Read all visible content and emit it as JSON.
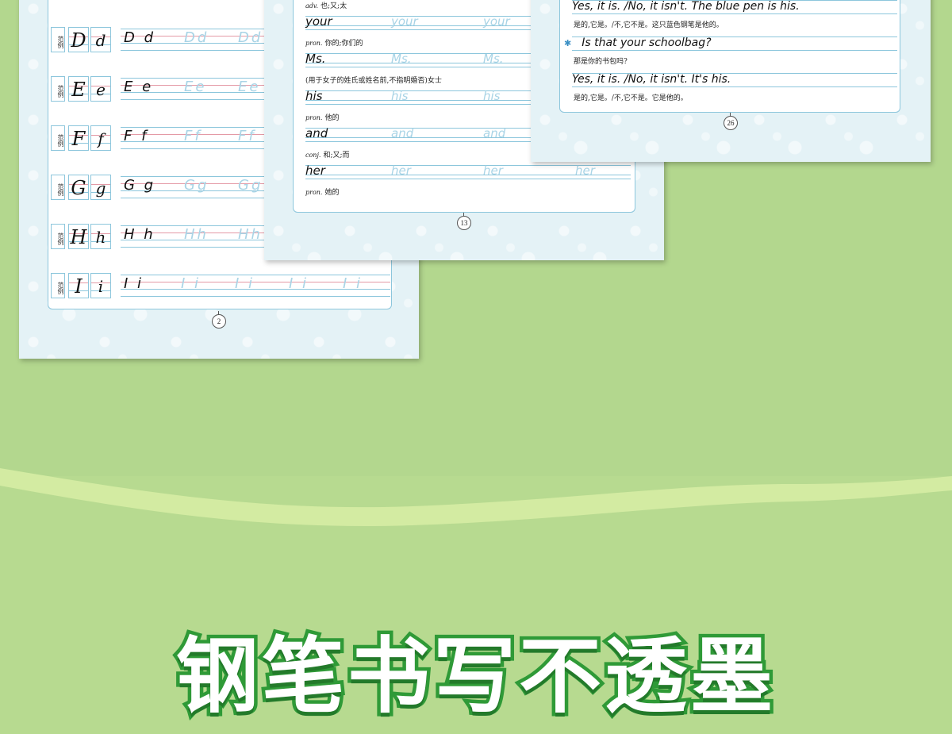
{
  "headline": "钢笔书写不透墨",
  "colors": {
    "background": "#b3d78e",
    "wave": "#d3eba2",
    "headline_fill": "#ffffff",
    "headline_outline": "#2f9a37",
    "guide_line": "#8cc6dc",
    "trace_text": "#a9d4e6"
  },
  "sheet_letters": {
    "sample_label": "范例",
    "page_number": "2",
    "rows": [
      {
        "upper": "D",
        "lower": "d",
        "solid": "D d",
        "trace": "Dd",
        "trace_count": 2
      },
      {
        "upper": "E",
        "lower": "e",
        "solid": "E e",
        "trace": "Ee",
        "trace_count": 2
      },
      {
        "upper": "F",
        "lower": "f",
        "solid": "F f",
        "trace": "Ff",
        "trace_count": 2
      },
      {
        "upper": "G",
        "lower": "g",
        "solid": "G g",
        "trace": "Gg",
        "trace_count": 2
      },
      {
        "upper": "H",
        "lower": "h",
        "solid": "H h",
        "trace": "Hh",
        "trace_count": 2
      },
      {
        "upper": "I",
        "lower": "i",
        "solid": "I i",
        "trace": "I i",
        "trace_count": 4
      }
    ]
  },
  "sheet_words": {
    "page_number": "13",
    "entries": [
      {
        "gloss_pos": "adv.",
        "gloss_text": "也;又;太",
        "word": "your",
        "trace_count": 2
      },
      {
        "gloss_pos": "pron.",
        "gloss_text": "你的;你们的",
        "word": "Ms.",
        "trace_count": 2
      },
      {
        "gloss_pos": "",
        "gloss_text": "(用于女子的姓氏或姓名前,不指明婚否)女士",
        "word": "his",
        "trace_count": 2
      },
      {
        "gloss_pos": "pron.",
        "gloss_text": "他的",
        "word": "and",
        "trace_count": 2
      },
      {
        "gloss_pos": "conj.",
        "gloss_text": "和;又;而",
        "word": "her",
        "trace_count": 3
      }
    ],
    "last_gloss_pos": "pron.",
    "last_gloss_text": "她的"
  },
  "sheet_sentences": {
    "page_number": "26",
    "items": [
      {
        "type": "en",
        "text": "Yes, it is. /No, it isn't. The blue pen is his."
      },
      {
        "type": "zh",
        "text": "是的,它是。/不,它不是。这只蓝色钢笔是他的。"
      },
      {
        "type": "en-star",
        "text": "Is that your schoolbag?"
      },
      {
        "type": "zh",
        "text": "那是你的书包吗?"
      },
      {
        "type": "en",
        "text": "Yes, it is. /No, it isn't. It's his."
      },
      {
        "type": "zh",
        "text": "是的,它是。/不,它不是。它是他的。"
      }
    ]
  }
}
